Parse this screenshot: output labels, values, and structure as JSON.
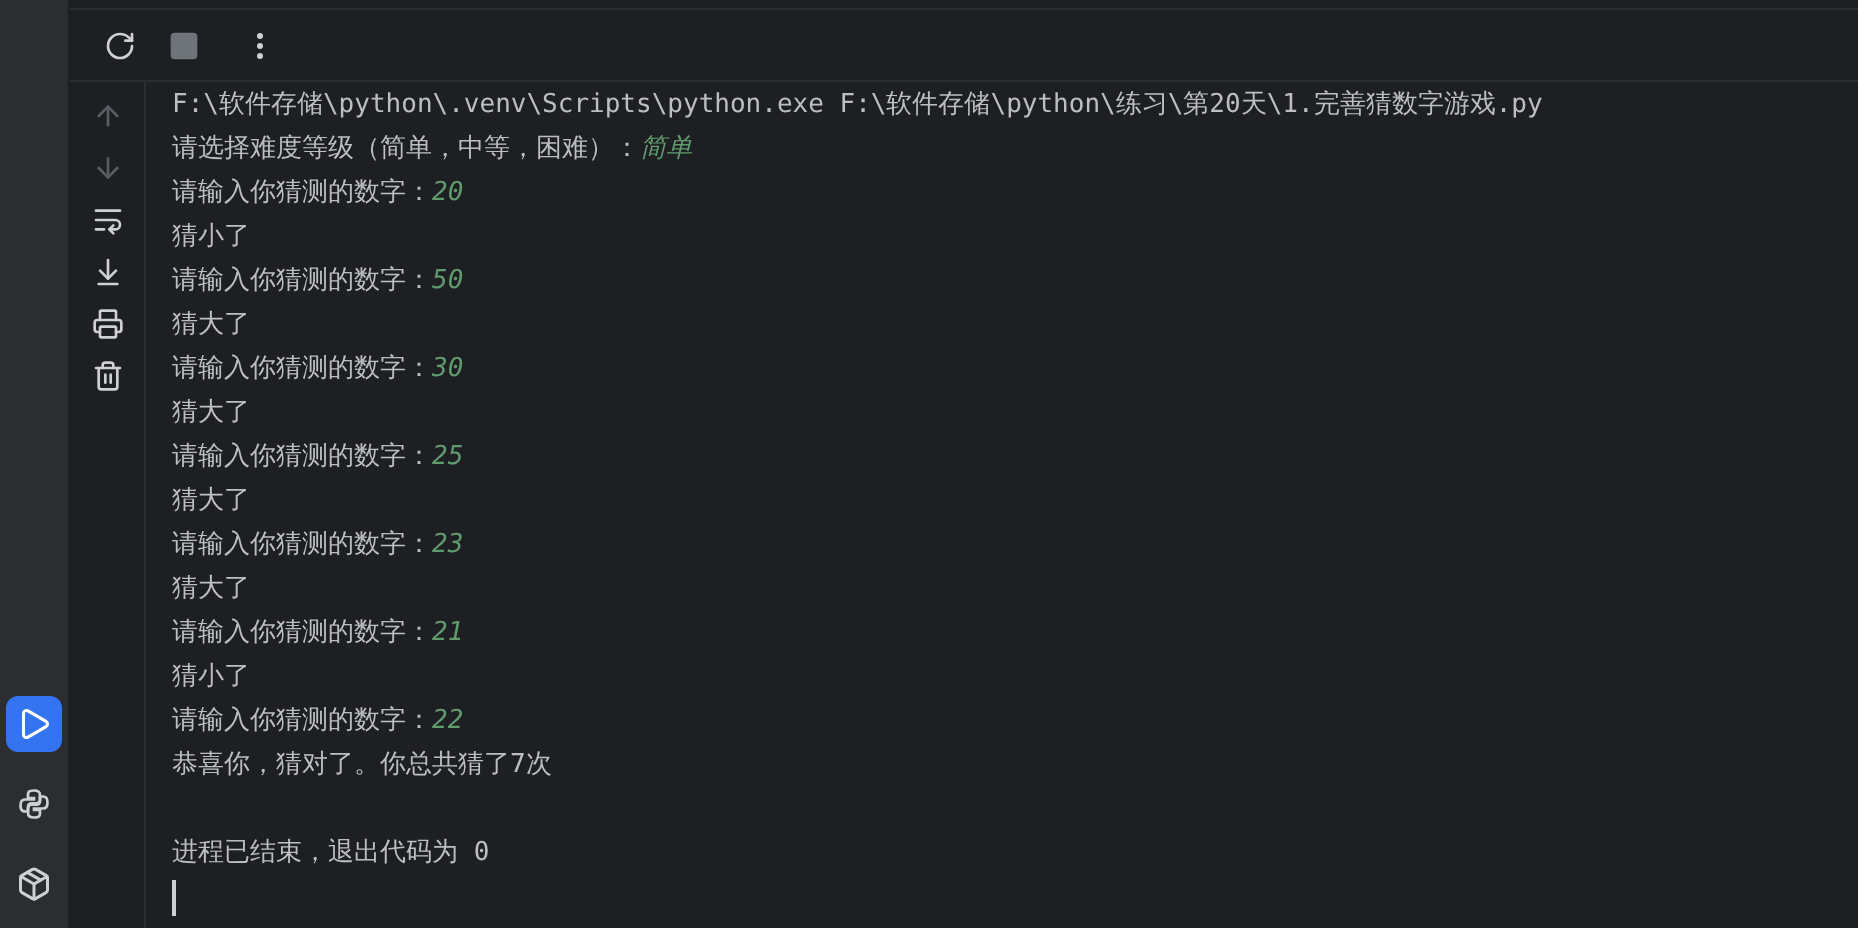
{
  "tool_strip": [
    {
      "kind": "run",
      "selected": true
    },
    {
      "kind": "python",
      "selected": false
    },
    {
      "kind": "packages",
      "selected": false
    }
  ],
  "console_toolbar": [
    {
      "kind": "rerun",
      "disabled": false
    },
    {
      "kind": "stop",
      "disabled": true
    },
    {
      "kind": "more",
      "disabled": false
    }
  ],
  "side_actions": [
    {
      "kind": "up",
      "disabled": true
    },
    {
      "kind": "down",
      "disabled": true
    },
    {
      "kind": "wrap",
      "disabled": false
    },
    {
      "kind": "scroll-end",
      "disabled": false
    },
    {
      "kind": "print",
      "disabled": false
    },
    {
      "kind": "delete",
      "disabled": false
    }
  ],
  "console_lines": [
    {
      "text": "F:\\软件存储\\python\\.venv\\Scripts\\python.exe F:\\软件存储\\python\\练习\\第20天\\1.完善猜数字游戏.py"
    },
    {
      "text": "请选择难度等级（简单，中等，困难）：",
      "input": "简单"
    },
    {
      "text": "请输入你猜测的数字：",
      "input": "20"
    },
    {
      "text": "猜小了"
    },
    {
      "text": "请输入你猜测的数字：",
      "input": "50"
    },
    {
      "text": "猜大了"
    },
    {
      "text": "请输入你猜测的数字：",
      "input": "30"
    },
    {
      "text": "猜大了"
    },
    {
      "text": "请输入你猜测的数字：",
      "input": "25"
    },
    {
      "text": "猜大了"
    },
    {
      "text": "请输入你猜测的数字：",
      "input": "23"
    },
    {
      "text": "猜大了"
    },
    {
      "text": "请输入你猜测的数字：",
      "input": "21"
    },
    {
      "text": "猜小了"
    },
    {
      "text": "请输入你猜测的数字：",
      "input": "22"
    },
    {
      "text": "恭喜你，猜对了。你总共猜了7次"
    }
  ],
  "exit_message": "进程已结束，退出代码为 0"
}
